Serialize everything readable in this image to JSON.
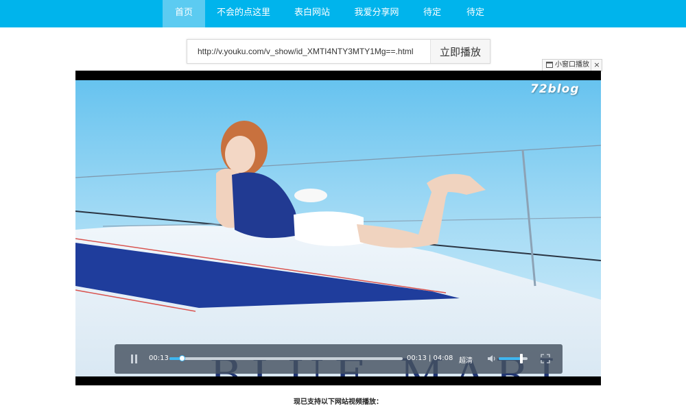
{
  "nav": {
    "items": [
      {
        "label": "首页",
        "active": true
      },
      {
        "label": "不会的点这里",
        "active": false
      },
      {
        "label": "表白网站",
        "active": false
      },
      {
        "label": "我爱分享网",
        "active": false
      },
      {
        "label": "待定",
        "active": false
      },
      {
        "label": "待定",
        "active": false
      }
    ]
  },
  "search": {
    "url_value": "http://v.youku.com/v_show/id_XMTI4NTY3MTY1Mg==.html",
    "play_label": "立即播放"
  },
  "mini_player": {
    "label": "小窗口播放",
    "close": "×"
  },
  "video": {
    "watermark": "72blog",
    "background_text": "BLUE MARI"
  },
  "controls": {
    "current_time": "00:13",
    "time_display": "00:13 | 04:08",
    "quality": "超清",
    "progress": 0.052,
    "volume": 0.78
  },
  "footer": {
    "support_text": "现已支持以下网站视频播放："
  },
  "colors": {
    "nav_bg": "#00b4ec",
    "nav_active": "#5ccbf1",
    "progress": "#3fb6f0"
  }
}
